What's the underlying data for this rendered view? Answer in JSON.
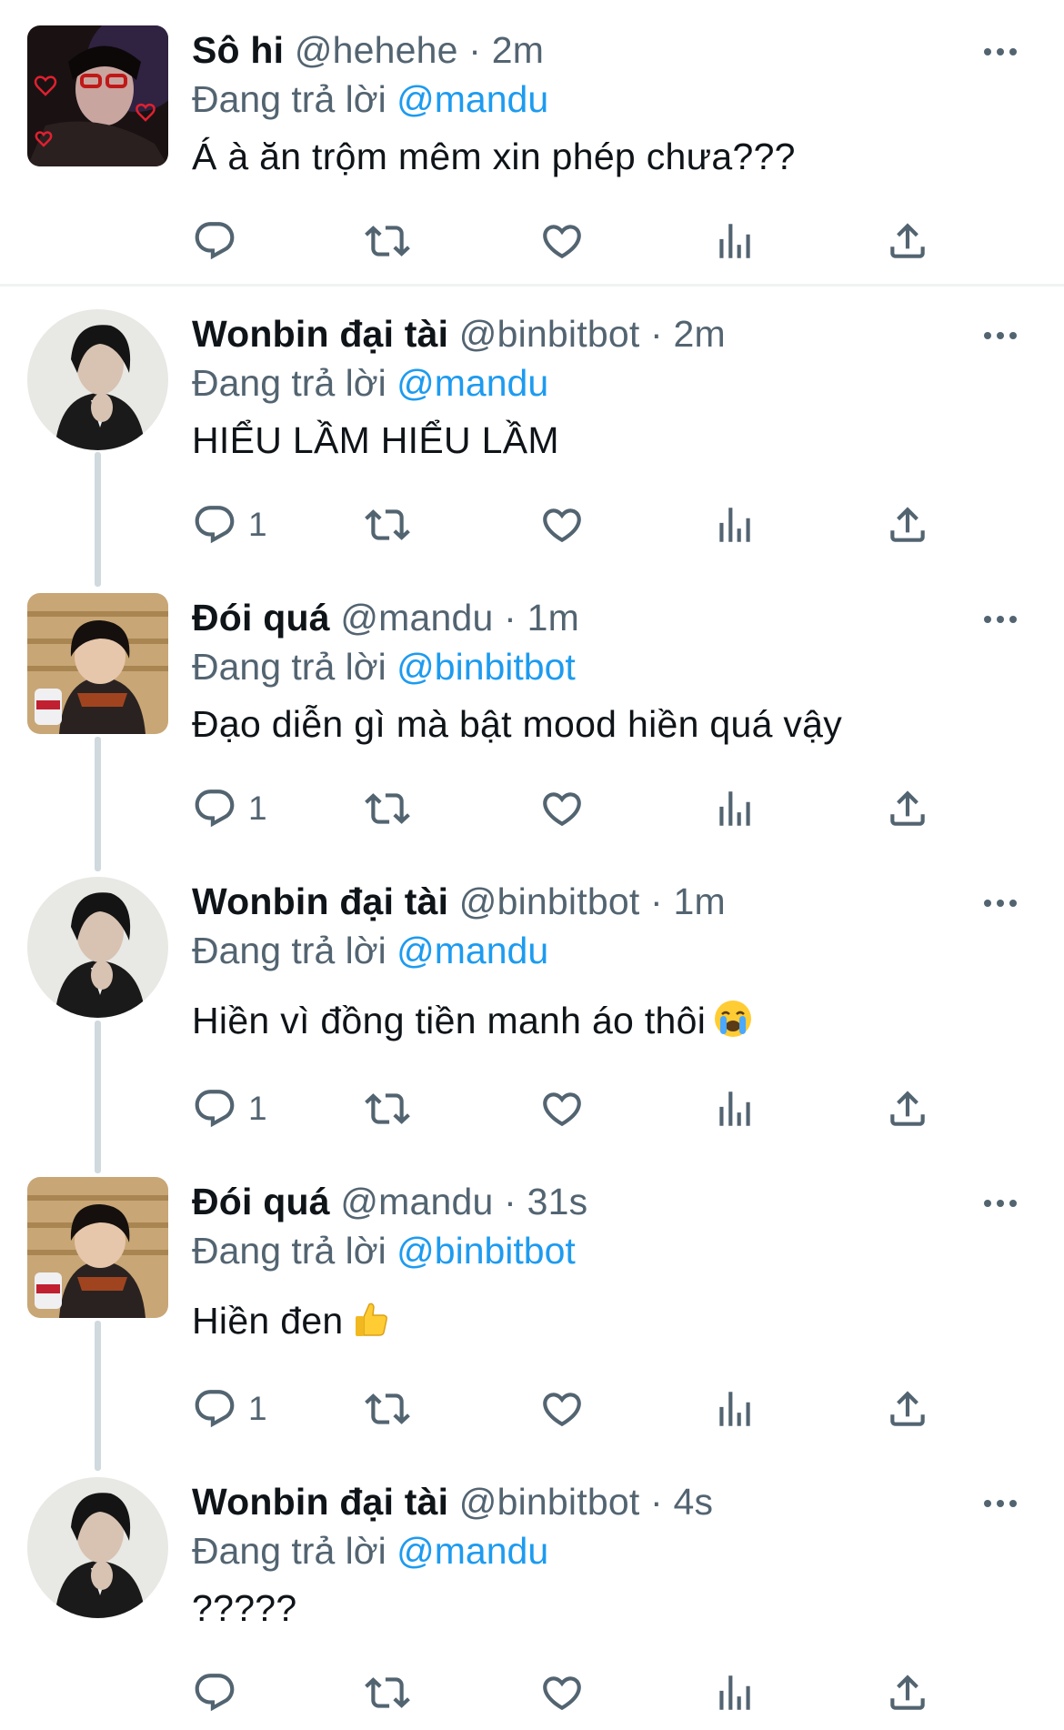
{
  "tweets": [
    {
      "name": "Sô hi",
      "handle": "@hehehe",
      "time": "2m",
      "reply_prefix": "Đang trả lời",
      "reply_to": "@mandu",
      "text": "Á à ăn trộm mêm xin phép chưa???",
      "reply_count": ""
    },
    {
      "name": "Wonbin đại tài",
      "handle": "@binbitbot",
      "time": "2m",
      "reply_prefix": "Đang trả lời",
      "reply_to": "@mandu",
      "text": "HIỂU LẦM HIỂU LẦM",
      "reply_count": "1"
    },
    {
      "name": "Đói quá",
      "handle": "@mandu",
      "time": "1m",
      "reply_prefix": "Đang trả lời",
      "reply_to": "@binbitbot",
      "text": "Đạo diễn gì mà bật mood hiền quá vậy",
      "reply_count": "1"
    },
    {
      "name": "Wonbin đại tài",
      "handle": "@binbitbot",
      "time": "1m",
      "reply_prefix": "Đang trả lời",
      "reply_to": "@mandu",
      "text": "Hiền vì đồng tiền manh áo thôi",
      "emoji": "crying-face",
      "reply_count": "1"
    },
    {
      "name": "Đói quá",
      "handle": "@mandu",
      "time": "31s",
      "reply_prefix": "Đang trả lời",
      "reply_to": "@binbitbot",
      "text": "Hiền đen",
      "emoji": "thumbs-up",
      "reply_count": "1"
    },
    {
      "name": "Wonbin đại tài",
      "handle": "@binbitbot",
      "time": "4s",
      "reply_prefix": "Đang trả lời",
      "reply_to": "@mandu",
      "text": "?????",
      "reply_count": ""
    }
  ],
  "separator_dot": "·",
  "icons": [
    "reply-icon",
    "retweet-icon",
    "like-icon",
    "views-icon",
    "share-icon",
    "more-icon"
  ],
  "colors": {
    "text": "#0f1419",
    "secondary": "#536471",
    "link": "#1d9bf0",
    "thread_line": "#cfd9de"
  }
}
